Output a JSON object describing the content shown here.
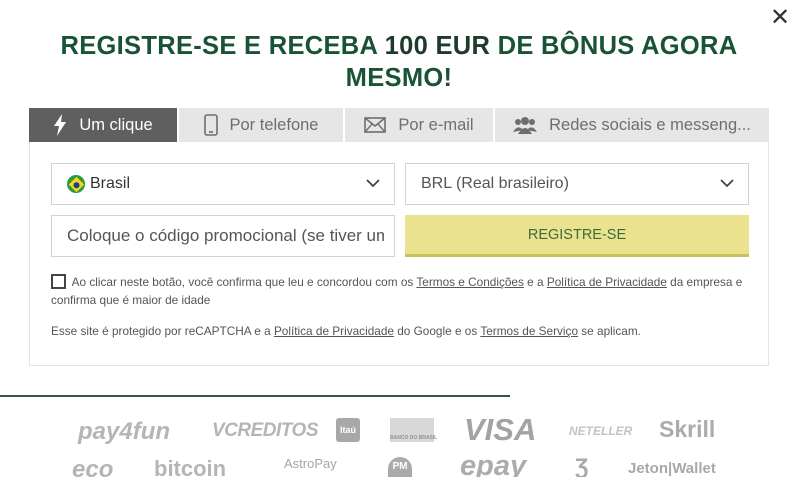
{
  "modal": {
    "headline_part1": "REGISTRE-SE E RECEBA ",
    "headline_amount": "100 EUR",
    "headline_part2": " DE BÔNUS AGORA MESMO!"
  },
  "tabs": [
    {
      "label": "Um clique",
      "icon": "lightning-icon",
      "active": true
    },
    {
      "label": "Por telefone",
      "icon": "phone-icon",
      "active": false
    },
    {
      "label": "Por e-mail",
      "icon": "envelope-icon",
      "active": false
    },
    {
      "label": "Redes sociais e messeng...",
      "icon": "users-icon",
      "active": false
    }
  ],
  "form": {
    "country": "Brasil",
    "currency": "BRL (Real brasileiro)",
    "promo_placeholder": "Coloque o código promocional (se tiver um)",
    "register_button": "REGISTRE-SE"
  },
  "consent": {
    "text_before": "Ao clicar neste botão, você confirma que leu e concordou com os ",
    "terms_link": "Termos e Condições",
    "text_middle": " e a ",
    "privacy_link": "Política de Privacidade",
    "text_after": " da empresa e confirma que é maior de idade"
  },
  "recaptcha": {
    "text_before": "Esse site é protegido por reCAPTCHA e a ",
    "privacy_link": "Política de Privacidade",
    "text_middle": " do Google e os ",
    "terms_link": "Termos de Serviço",
    "text_after": " se aplicam."
  },
  "payment_logos": {
    "row1": [
      "pay4fun",
      "VCREDITOS",
      "Itaú",
      "BANCO DO BRASIL",
      "VISA",
      "NETELLER",
      "Skrill"
    ],
    "row2": [
      "eco",
      "bitcoin",
      "AstroPay",
      "PM",
      "epay",
      "Jeton|Wallet"
    ]
  },
  "colors": {
    "headline": "#1a5235",
    "active_tab": "#5f5f5f",
    "register_button": "#ebe28f",
    "divider": "#2c5b3d"
  }
}
